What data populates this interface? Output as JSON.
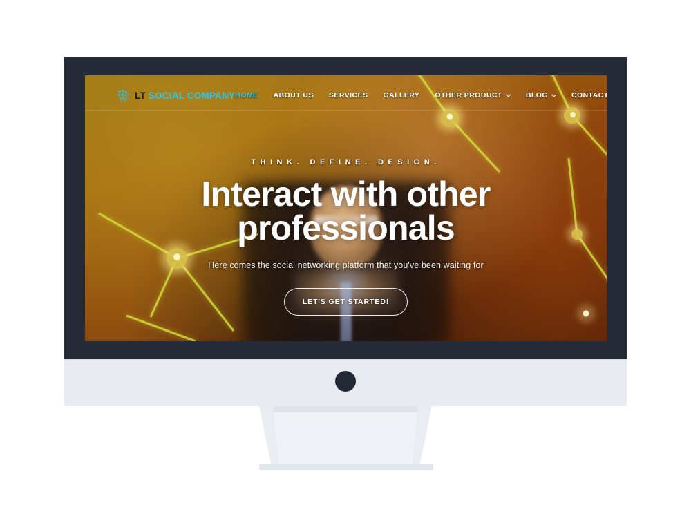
{
  "site": {
    "brand": {
      "icon": "network-nodes-icon",
      "prefix": "LT",
      "name": "SOCIAL COMPANY",
      "accent_color": "#29c6f0"
    },
    "nav": [
      {
        "label": "HOME",
        "active": true,
        "has_dropdown": false
      },
      {
        "label": "ABOUT US",
        "active": false,
        "has_dropdown": false
      },
      {
        "label": "SERVICES",
        "active": false,
        "has_dropdown": false
      },
      {
        "label": "GALLERY",
        "active": false,
        "has_dropdown": false
      },
      {
        "label": "OTHER PRODUCT",
        "active": false,
        "has_dropdown": true
      },
      {
        "label": "BLOG",
        "active": false,
        "has_dropdown": true
      },
      {
        "label": "CONTACT US",
        "active": false,
        "has_dropdown": false
      }
    ],
    "hero": {
      "eyebrow": "THINK. DEFINE. DESIGN.",
      "title_line1": "Interact with other",
      "title_line2": "professionals",
      "subtitle": "Here comes the social networking platform that you've been waiting for",
      "cta_label": "LET'S GET STARTED!"
    }
  },
  "device": {
    "type": "desktop-monitor-mockup",
    "bezel_color": "#262b38",
    "chin_color": "#e8ebf0",
    "stand_color": "#e9ecf1",
    "page_background": "#ffffff"
  }
}
